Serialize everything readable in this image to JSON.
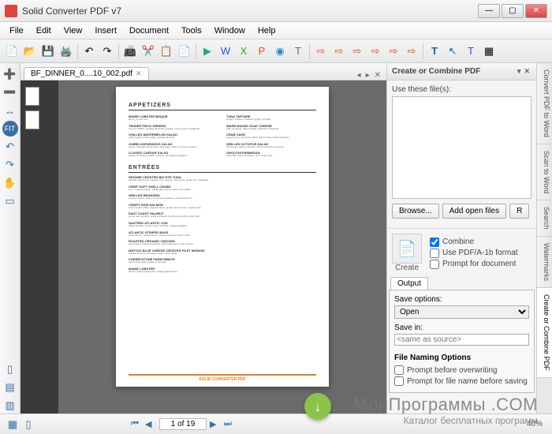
{
  "window": {
    "title": "Solid Converter PDF v7"
  },
  "menu": [
    "File",
    "Edit",
    "View",
    "Insert",
    "Document",
    "Tools",
    "Window",
    "Help"
  ],
  "tab": {
    "label": "BF_DINNER_0....10_002.pdf"
  },
  "doc": {
    "sec1": "APPETIZERS",
    "sec2": "ENTRÉES",
    "appetizers_left": [
      {
        "n": "MAINE LOBSTER BISQUE",
        "d": "sherry, vol au vent"
      },
      {
        "n": "TENDER FIELD GREENS",
        "d": "summer radish, candied hazelnuts, grapes, meyer lemon vinaigrette"
      },
      {
        "n": "CHILLED WATERMELON SALAD",
        "d": "wild arugula, ricotta salata, toasted almonds"
      },
      {
        "n": "JUMBO ASPARAGUS SALAD",
        "d": "speck, marinated anchovies, quail eggs, caper red wine emulsion"
      },
      {
        "n": "CLASSIC CAESAR SALAD",
        "d": "hearts of romaine, focille croutons, parmigiano reggiano"
      }
    ],
    "appetizers_right": [
      {
        "n": "TUNA TARTARE",
        "d": "wonton crackers, sesame, ginger, avocado"
      },
      {
        "n": "WARM BAKED GOAT CHEESE",
        "d": "ruby red beets, baby arugula, pistachio vinaigrette"
      },
      {
        "n": "CRAB CAKE",
        "d": "sweet & sour cucumber salad, cilantro aioli, toasted peanuts"
      },
      {
        "n": "GRILLED OCTOPUS SALAD",
        "d": "chick peas, olives, pancetta, cherry tomatoes, focaccia"
      },
      {
        "n": "GNOCCHI PARMESAN",
        "d": "king crab, cherry tomatoes, corn, snap peas"
      }
    ],
    "entrees": [
      {
        "n": "SESAME CRUSTED BIG EYE TUNA",
        "d": "shiitake mushrooms, jasmine rice, carrots, snow peas, ginger soy vinaigrette"
      },
      {
        "n": "CRISP SOFT SHELL CRABS",
        "d": "corn, roasted pepper, artisannale chorizo, sauce remoulade"
      },
      {
        "n": "GRILLED BRANZINO",
        "d": "summer beans, olives, sun dried tomatoes, preserved lemon"
      },
      {
        "n": "CRISPY SKIN SALMON",
        "d": "sweet potato salad, smoked bacon, ginger carrot puree, english peas"
      },
      {
        "n": "EAST COAST HALIBUT",
        "d": "lemon herb gnocchi, petite portobello mushrooms, jumbo lump crab"
      },
      {
        "n": "SAUTÉED ATLANTIC COD",
        "d": "wilted spinach, tomato confit, zucchini, roasted eggplant"
      },
      {
        "n": "ATLANTIC STRIPED BASS",
        "d": "petite shrimp, manila clams, mussel, smoked chorizo broth"
      },
      {
        "n": "ROASTED ORGANIC CHICKEN",
        "d": "sweet garlic whipped potatoes, wild mushrooms, green beans"
      },
      {
        "n": "MAYTAG BLUE CHEESE CRUSTED FILET MIGNON",
        "d": "roasted heirloom tomatoes, basil, potato sticks"
      },
      {
        "n": "CHERRYSTONE FARM RIBEYE",
        "d": "duck confit inside potatoes, sea salt"
      },
      {
        "n": "MAINE LOBSTER",
        "d": "brandy glazed asparagus, roasted garlic butter"
      }
    ],
    "footer": "SOLID CONVERTER PDF"
  },
  "side": {
    "title": "Create or Combine PDF",
    "use_label": "Use these file(s):",
    "browse": "Browse...",
    "add_open": "Add open files",
    "create": "Create",
    "combine": "Combine",
    "pdfa": "Use PDF/A-1b format",
    "prompt_doc": "Prompt for document",
    "output_tab": "Output",
    "save_opts": "Save options:",
    "save_opt_val": "Open",
    "save_in": "Save in:",
    "save_in_ph": "<same as source>",
    "fno": "File Naming Options",
    "prompt_over": "Prompt before overwriting",
    "prompt_fn": "Prompt for file name before saving"
  },
  "rtabs": [
    "Convert PDF to Word",
    "Scan to Word",
    "Search",
    "Watermarks",
    "Create or Combine PDF"
  ],
  "status": {
    "page": "1 of 19",
    "zoom": "40%"
  },
  "watermark": {
    "l1": "МоиПрограммы .COM",
    "l2": "Каталог бесплатных программ"
  }
}
